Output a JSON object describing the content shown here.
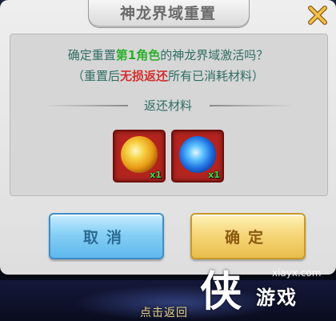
{
  "dialog": {
    "title": "神龙界域重置",
    "line1": {
      "prefix": "确定重置",
      "highlight": "第1角色",
      "suffix": "的神龙界域激活吗？"
    },
    "line2": {
      "prefix": "（重置后",
      "highlight": "无损返还",
      "suffix": "所有已消耗材料）"
    },
    "section_title": "返还材料",
    "items": [
      {
        "icon": "gold-orb-icon",
        "quantity": "x1"
      },
      {
        "icon": "blue-orb-icon",
        "quantity": "x1"
      }
    ],
    "buttons": {
      "cancel": "取消",
      "confirm": "确定"
    }
  },
  "background": {
    "button_label": "点击返回"
  },
  "watermark": {
    "site": "xiayx.com",
    "char": "侠",
    "name": "游戏"
  },
  "colors": {
    "accent_text": "#2f6e63",
    "highlight_green": "#2cb12c",
    "highlight_red": "#d43030",
    "cancel_button": "#86cff5",
    "confirm_button": "#f6d77a"
  }
}
